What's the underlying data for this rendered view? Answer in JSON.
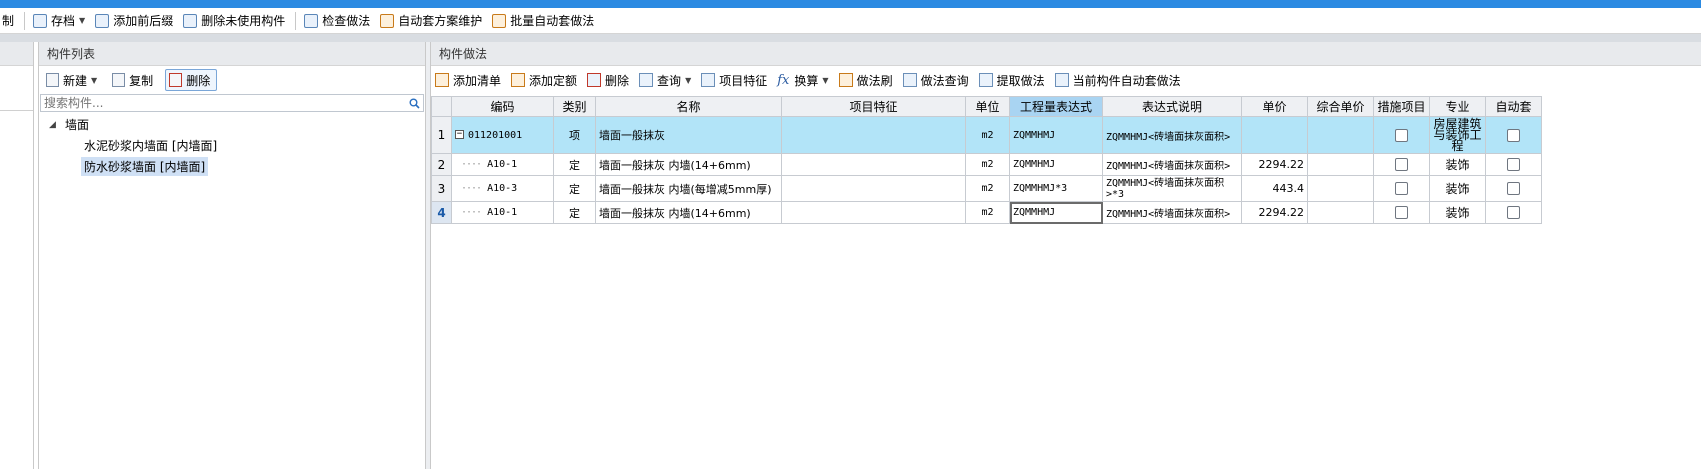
{
  "toolbar": {
    "items": [
      {
        "label": "制",
        "icon": "cut-icon"
      },
      {
        "label": "存档",
        "icon": "archive-icon",
        "dropdown": true
      },
      {
        "label": "添加前后缀",
        "icon": "add-prefix-icon"
      },
      {
        "label": "删除未使用构件",
        "icon": "delete-unused-icon"
      },
      {
        "label": "检查做法",
        "icon": "check-method-icon"
      },
      {
        "label": "自动套方案维护",
        "icon": "auto-scheme-icon"
      },
      {
        "label": "批量自动套做法",
        "icon": "batch-auto-icon"
      }
    ]
  },
  "component_list": {
    "title": "构件列表",
    "new_label": "新建",
    "copy_label": "复制",
    "delete_label": "删除",
    "search_placeholder": "搜索构件...",
    "tree": {
      "root": "墙面",
      "children": [
        "水泥砂浆内墙面 [内墙面]",
        "防水砂浆墙面 [内墙面]"
      ]
    }
  },
  "methods": {
    "title": "构件做法",
    "tools": [
      {
        "label": "添加清单",
        "icon": "add-list-icon"
      },
      {
        "label": "添加定额",
        "icon": "add-quota-icon"
      },
      {
        "label": "删除",
        "icon": "delete-icon"
      },
      {
        "label": "查询",
        "icon": "query-icon",
        "dropdown": true
      },
      {
        "label": "项目特征",
        "icon": "feature-icon"
      },
      {
        "label": "换算",
        "icon": "fx-icon",
        "dropdown": true
      },
      {
        "label": "做法刷",
        "icon": "brush-icon"
      },
      {
        "label": "做法查询",
        "icon": "method-query-icon"
      },
      {
        "label": "提取做法",
        "icon": "extract-icon"
      },
      {
        "label": "当前构件自动套做法",
        "icon": "auto-apply-icon"
      }
    ],
    "columns": [
      "编码",
      "类别",
      "名称",
      "项目特征",
      "单位",
      "工程量表达式",
      "表达式说明",
      "单价",
      "综合单价",
      "措施项目",
      "专业",
      "自动套"
    ],
    "rows": [
      {
        "num": "1",
        "code": "011201001",
        "type": "项",
        "name": "墙面一般抹灰",
        "feature": "",
        "unit": "m2",
        "expr": "ZQMMHMJ",
        "desc": "ZQMMHMJ<砖墙面抹灰面积>",
        "price": "",
        "comp": "",
        "major": "房屋建筑与装饰工程"
      },
      {
        "num": "2",
        "code": "A10-1",
        "type": "定",
        "name": "墙面一般抹灰 内墙(14+6mm)",
        "feature": "",
        "unit": "m2",
        "expr": "ZQMMHMJ",
        "desc": "ZQMMHMJ<砖墙面抹灰面积>",
        "price": "2294.22",
        "comp": "",
        "major": "装饰"
      },
      {
        "num": "3",
        "code": "A10-3",
        "type": "定",
        "name": "墙面一般抹灰 内墙(每增减5mm厚)",
        "feature": "",
        "unit": "m2",
        "expr": "ZQMMHMJ*3",
        "desc": "ZQMMHMJ<砖墙面抹灰面积>*3",
        "price": "443.4",
        "comp": "",
        "major": "装饰"
      },
      {
        "num": "4",
        "code": "A10-1",
        "type": "定",
        "name": "墙面一般抹灰 内墙(14+6mm)",
        "feature": "",
        "unit": "m2",
        "expr": "ZQMMHMJ",
        "desc": "ZQMMHMJ<砖墙面抹灰面积>",
        "price": "2294.22",
        "comp": "",
        "major": "装饰"
      }
    ]
  }
}
